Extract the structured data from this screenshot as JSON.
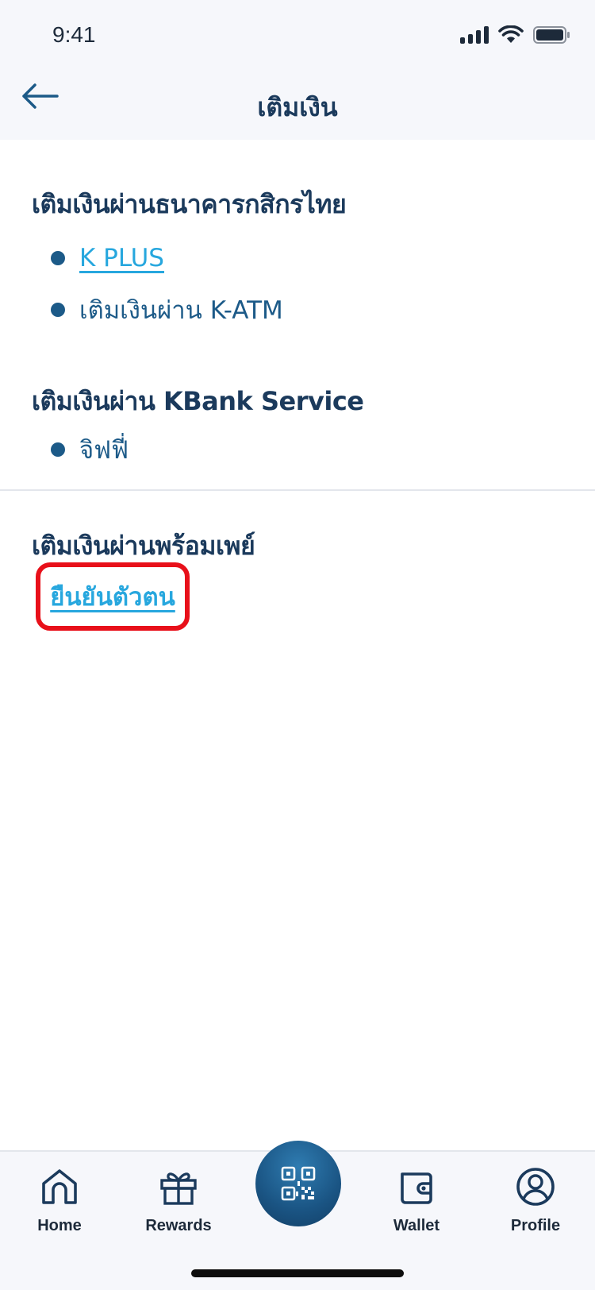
{
  "status_bar": {
    "time": "9:41"
  },
  "header": {
    "title": "เติมเงิน"
  },
  "sections": {
    "kbank": {
      "heading": "เติมเงินผ่านธนาคารกสิกรไทย",
      "items": [
        "K PLUS",
        "เติมเงินผ่าน K-ATM"
      ]
    },
    "kbank_service": {
      "heading": "เติมเงินผ่าน KBank Service",
      "items": [
        "จิฟฟี่"
      ]
    },
    "promptpay": {
      "heading": "เติมเงินผ่านพร้อมเพย์",
      "verify_label": "ยืนยันตัวตน"
    }
  },
  "bottom_nav": {
    "home": "Home",
    "rewards": "Rewards",
    "wallet": "Wallet",
    "profile": "Profile"
  },
  "colors": {
    "primary_text": "#1b3a5c",
    "link": "#27a7de",
    "bullet": "#1c5a88",
    "highlight": "#e8101a"
  }
}
